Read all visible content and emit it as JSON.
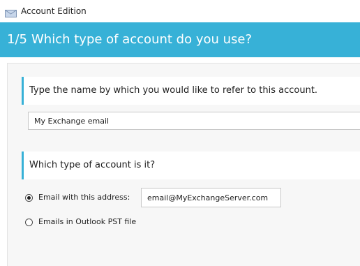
{
  "window": {
    "title": "Account Edition",
    "icon": "envelope-icon"
  },
  "header": {
    "step": "1/5",
    "question": "Which type of account do you use?",
    "background_color": "#37b1d7"
  },
  "name_section": {
    "label": "Type the name by which you would like to refer to this account.",
    "value": "My Exchange email"
  },
  "type_section": {
    "label": "Which type of account is it?",
    "options": [
      {
        "label": "Email with this address:",
        "selected": true
      },
      {
        "label": "Emails in Outlook PST file",
        "selected": false
      }
    ],
    "email_value": "email@MyExchangeServer.com"
  }
}
